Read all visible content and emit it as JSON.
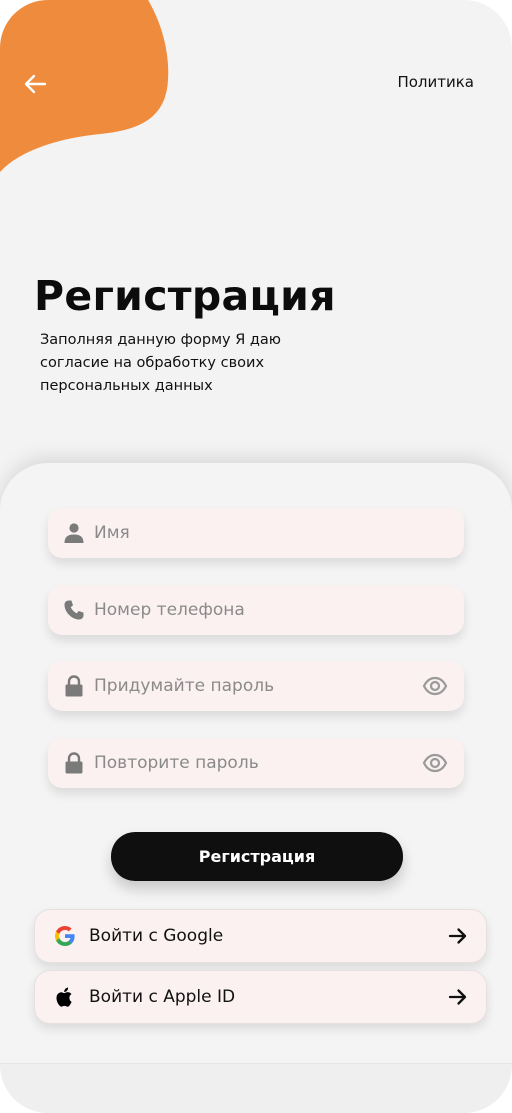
{
  "header": {
    "policy_label": "Политика"
  },
  "intro": {
    "title": "Регистрация",
    "subtitle": "Заполняя данную форму Я даю согласие на обработку своих персональных данных"
  },
  "form": {
    "name": {
      "placeholder": "Имя",
      "icon": "user-icon"
    },
    "phone": {
      "placeholder": "Номер телефона",
      "icon": "phone-icon"
    },
    "password": {
      "placeholder": "Придумайте пароль",
      "icon": "lock-icon"
    },
    "password_repeat": {
      "placeholder": "Повторите пароль",
      "icon": "lock-icon"
    },
    "submit_label": "Регистрация"
  },
  "social": {
    "google_label": "Войти с Google",
    "apple_label": "Войти с Apple ID"
  },
  "colors": {
    "accent": "#ef8b3d",
    "field_bg": "#fbf1f1",
    "button_bg": "#0f0f0f",
    "background": "#f3f3f3"
  }
}
